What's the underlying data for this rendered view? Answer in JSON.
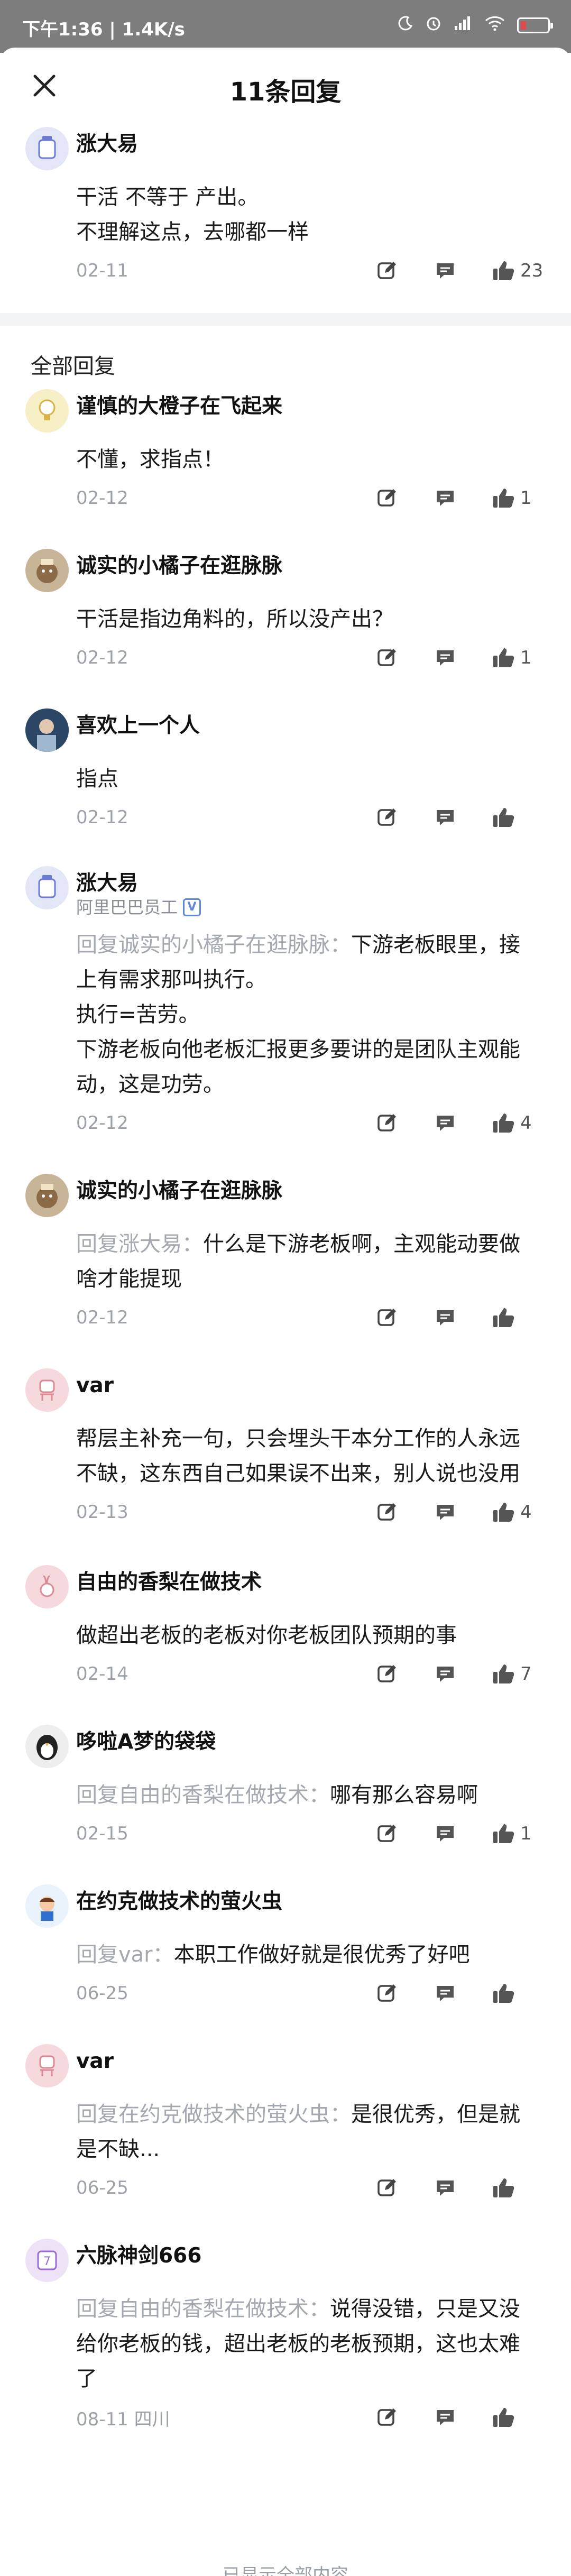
{
  "status_bar": {
    "left_text": "下午1:36 | 1.4K/s",
    "icons": [
      "moon-icon",
      "alarm-icon",
      "signal-icon",
      "wifi-icon",
      "battery-icon"
    ],
    "battery_level": 0.2,
    "battery_color": "#e34a4a"
  },
  "header": {
    "title": "11条回复",
    "close_icon": "close-icon"
  },
  "main_post": {
    "name": "涨大易",
    "lines": [
      "干活 不等于 产出。",
      "不理解这点，去哪都一样"
    ],
    "date": "02-11",
    "likes": "23"
  },
  "section_title": "全部回复",
  "replies": [
    {
      "name": "谨慎的大橙子在飞起来",
      "reply_to": "",
      "text": "不懂，求指点！",
      "date": "02-12",
      "likes": "1"
    },
    {
      "name": "诚实的小橘子在逛脉脉",
      "reply_to": "",
      "text": "干活是指边角料的，所以没产出？",
      "date": "02-12",
      "likes": "1"
    },
    {
      "name": "喜欢上一个人",
      "reply_to": "",
      "text": "指点",
      "date": "02-12",
      "likes": ""
    },
    {
      "name": "涨大易",
      "subtitle": "阿里巴巴员工",
      "reply_to": "回复诚实的小橘子在逛脉脉：",
      "text": "下游老板眼里，接上有需求那叫执行。\n执行=苦劳。\n下游老板向他老板汇报更多要讲的是团队主观能动，这是功劳。",
      "date": "02-12",
      "likes": "4"
    },
    {
      "name": "诚实的小橘子在逛脉脉",
      "reply_to": "回复涨大易：",
      "text": "什么是下游老板啊，主观能动要做啥才能提现",
      "date": "02-12",
      "likes": ""
    },
    {
      "name": "var",
      "reply_to": "",
      "text": "帮层主补充一句，只会埋头干本分工作的人永远不缺，这东西自己如果误不出来，别人说也没用",
      "date": "02-13",
      "likes": "4"
    },
    {
      "name": "自由的香梨在做技术",
      "reply_to": "",
      "text": "做超出老板的老板对你老板团队预期的事",
      "date": "02-14",
      "likes": "7"
    },
    {
      "name": "哆啦A梦的袋袋",
      "reply_to": "回复自由的香梨在做技术：",
      "text": "哪有那么容易啊",
      "date": "02-15",
      "likes": "1"
    },
    {
      "name": "在约克做技术的萤火虫",
      "reply_to": "回复var：",
      "text": "本职工作做好就是很优秀了好吧",
      "date": "06-25",
      "likes": ""
    },
    {
      "name": "var",
      "reply_to": "回复在约克做技术的萤火虫：",
      "text": "是很优秀，但是就是不缺...",
      "date": "06-25",
      "likes": ""
    },
    {
      "name": "六脉神剑666",
      "reply_to": "回复自由的香梨在做技术：",
      "text": "说得没错，只是又没给你老板的钱，超出老板的老板预期，这也太难了",
      "date": "08-11 四川",
      "likes": ""
    }
  ],
  "bottom_hint": "已显示全部内容"
}
